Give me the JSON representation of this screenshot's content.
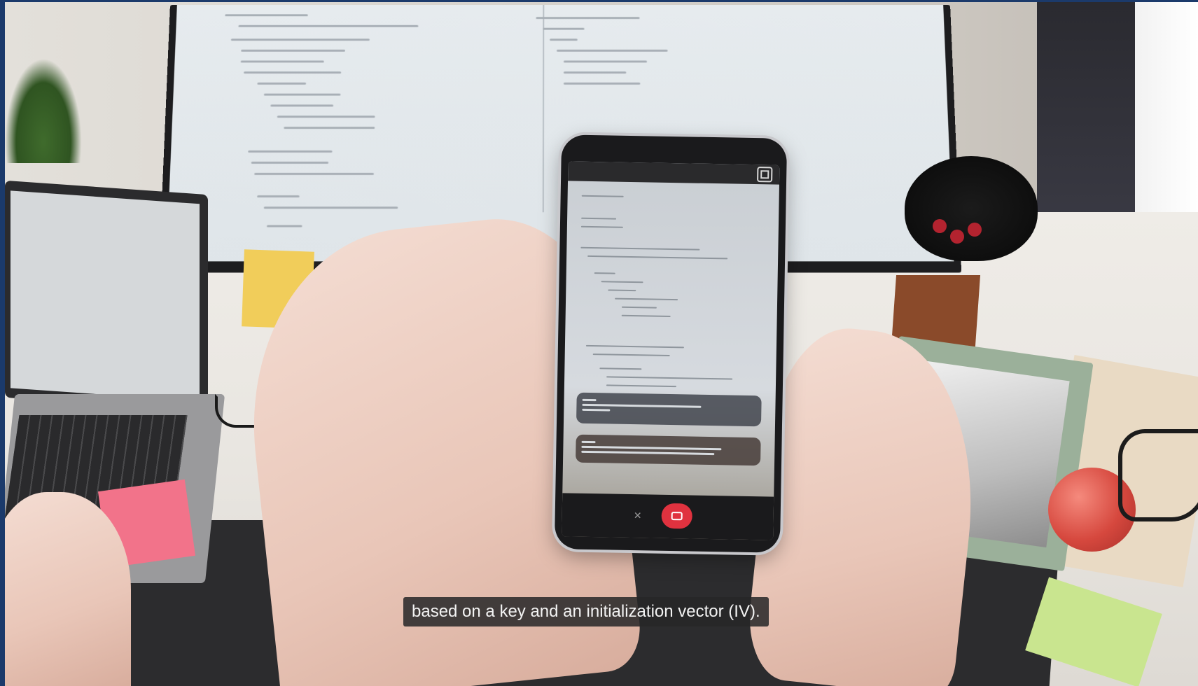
{
  "video": {
    "caption": "based on a key and an initialization vector (IV)."
  },
  "colors": {
    "border": "#1b3a6b",
    "caption_bg": "#262628",
    "record_button": "#e0323f"
  },
  "phone_app": {
    "icons": [
      "fullscreen-icon",
      "mute-icon",
      "video-camera-icon"
    ]
  }
}
